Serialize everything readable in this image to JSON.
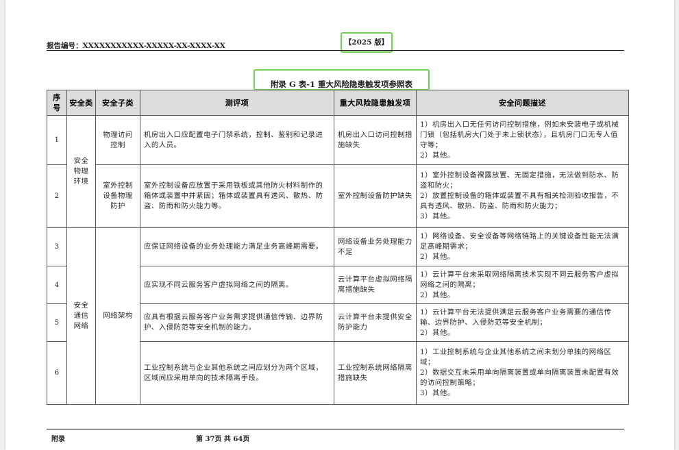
{
  "header": {
    "report_no": "报告编号：XXXXXXXXXXX-XXXXX-XX-XXXX-XX",
    "version": "【2025 版】"
  },
  "table_title": "附录 G  表-1  重大风险隐患触发项参照表",
  "columns": [
    "序号",
    "安全类",
    "安全子类",
    "测评项",
    "重大风险隐患触发项",
    "安全问题描述"
  ],
  "groups": {
    "env": "安全物理环境",
    "net": "安全通信网络"
  },
  "subclasses": {
    "s1": "物理访问控制",
    "s2": "室外控制设备物理防护",
    "s3": "网络架构"
  },
  "rows": [
    {
      "no": "1",
      "item": "机房出入口应配置电子门禁系统，控制、鉴别和记录进入的人员。",
      "trigger": "机房出入口访问控制措施缺失",
      "desc": [
        "1）机房出入口无任何访问控制措施，例如未安装电子或机械门锁（包括机房大门处于未上锁状态），且机房门口无专人值守等；",
        "2）其他。"
      ]
    },
    {
      "no": "2",
      "item": "室外控制设备应放置于采用铁板或其他防火材料制作的箱体或装置中并紧固；箱体或装置具有透风、散热、防盗、防雨和防火能力等。",
      "trigger": "室外控制设备防护缺失",
      "desc": [
        "1）室外控制设备裸露放置、无固定措施，无法做到防水、防盗和防火；",
        "2）放置控制设备的箱体或装置不具有相关检测验收报告，不具有透风、散热、防盗、防雨和防火能力；",
        "3）其他。"
      ]
    },
    {
      "no": "3",
      "item": "应保证网络设备的业务处理能力满足业务高峰期需要。",
      "trigger": "网络设备业务处理能力不足",
      "desc": [
        "1）网络设备、安全设备等网络链路上的关键设备性能无法满足高峰期需求；",
        "2）其他。"
      ]
    },
    {
      "no": "4",
      "item": "应实现不同云服务客户虚拟网络之间的隔离。",
      "trigger": "云计算平台虚拟网络隔离措施缺失",
      "desc": [
        "1）云计算平台未采取网络隔离技术实现不同云服务客户虚拟网络之间的隔离；",
        "2）其他。"
      ]
    },
    {
      "no": "5",
      "item": "应具有根据云服务客户业务需求提供通信传输、边界防护、入侵防范等安全机制的能力。",
      "trigger": "云计算平台未提供安全防护能力",
      "desc": [
        "1）云计算平台无法提供满足云服务客户业务需要的通信传输、边界防护、入侵防范等安全机制；",
        "2）其他。"
      ]
    },
    {
      "no": "6",
      "item": "工业控制系统与企业其他系统之间应划分为两个区域，区域间应采用单向的技术隔离手段。",
      "trigger": "工业控制系统网络隔离措施缺失",
      "desc": [
        "1）工业控制系统与企业其他系统之间未划分单独的网络区域；",
        "2）数据交互未采用单向隔离装置或单向隔离装置未配置有效的访问控制策略；",
        "3）其他。"
      ]
    }
  ],
  "footer": {
    "left": "附录",
    "page": "第 37页  共 64页"
  }
}
